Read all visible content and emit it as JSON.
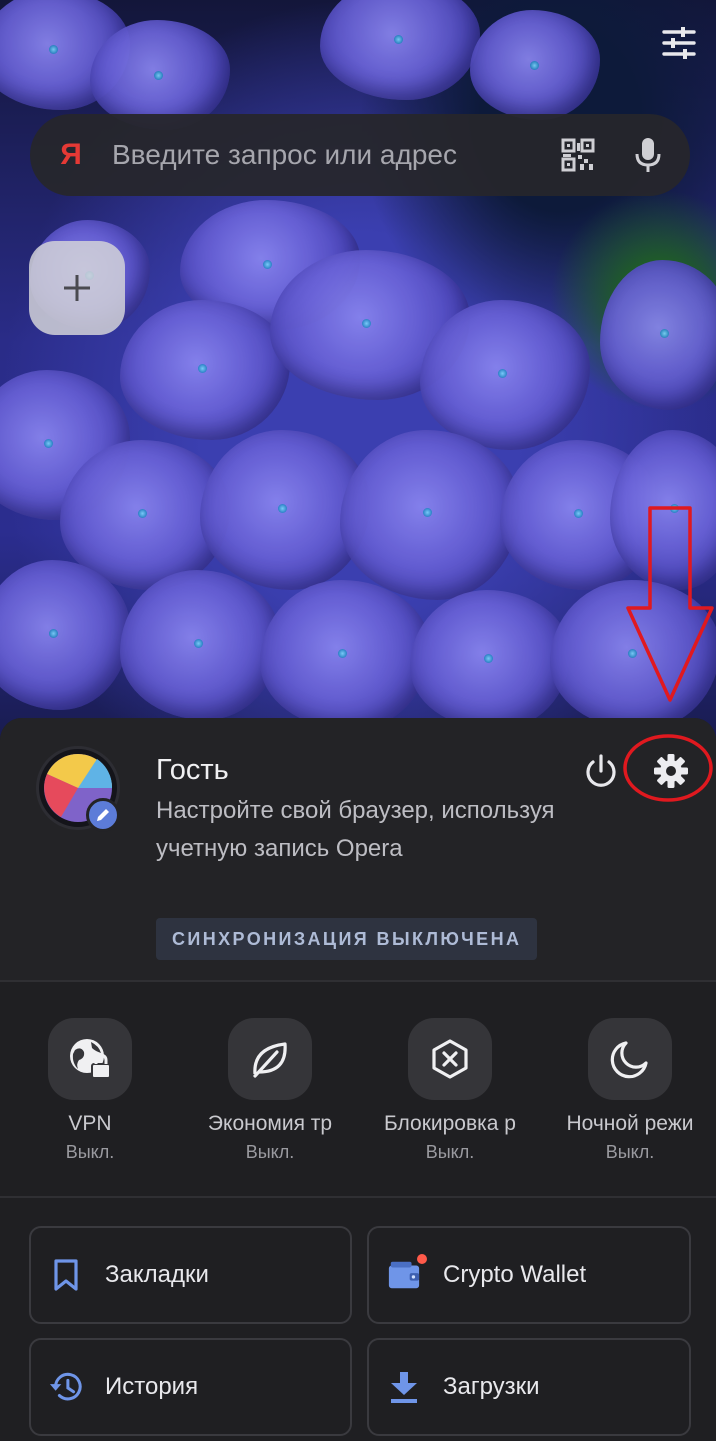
{
  "search": {
    "logo": "Я",
    "placeholder": "Введите запрос или адрес"
  },
  "icons": {
    "tune": "tune-sliders-icon",
    "qr": "qr-code-icon",
    "mic": "microphone-icon",
    "add": "plus-icon",
    "power": "power-icon",
    "settings": "gear-icon",
    "edit": "pencil-icon"
  },
  "speed_dial": {
    "add_symbol": "+"
  },
  "profile": {
    "name": "Гость",
    "description": "Настройте свой браузер, используя учетную запись Opera",
    "sync_status": "СИНХРОНИЗАЦИЯ ВЫКЛЮЧЕНА"
  },
  "toggles": [
    {
      "label": "VPN",
      "status": "Выкл.",
      "icon": "globe-lock-icon"
    },
    {
      "label": "Экономия тр",
      "status": "Выкл.",
      "icon": "leaf-icon"
    },
    {
      "label": "Блокировка р",
      "status": "Выкл.",
      "icon": "ad-block-icon"
    },
    {
      "label": "Ночной режи",
      "status": "Выкл.",
      "icon": "moon-icon"
    }
  ],
  "menu": [
    {
      "label": "Закладки",
      "icon": "bookmark-icon"
    },
    {
      "label": "Crypto Wallet",
      "icon": "wallet-icon"
    },
    {
      "label": "История",
      "icon": "history-icon"
    },
    {
      "label": "Загрузки",
      "icon": "download-icon"
    }
  ],
  "colors": {
    "accent_blue": "#5c7cd8",
    "annotation_red": "#e0191f",
    "notification_dot": "#ff5a4a",
    "yandex_red": "#e53935"
  }
}
